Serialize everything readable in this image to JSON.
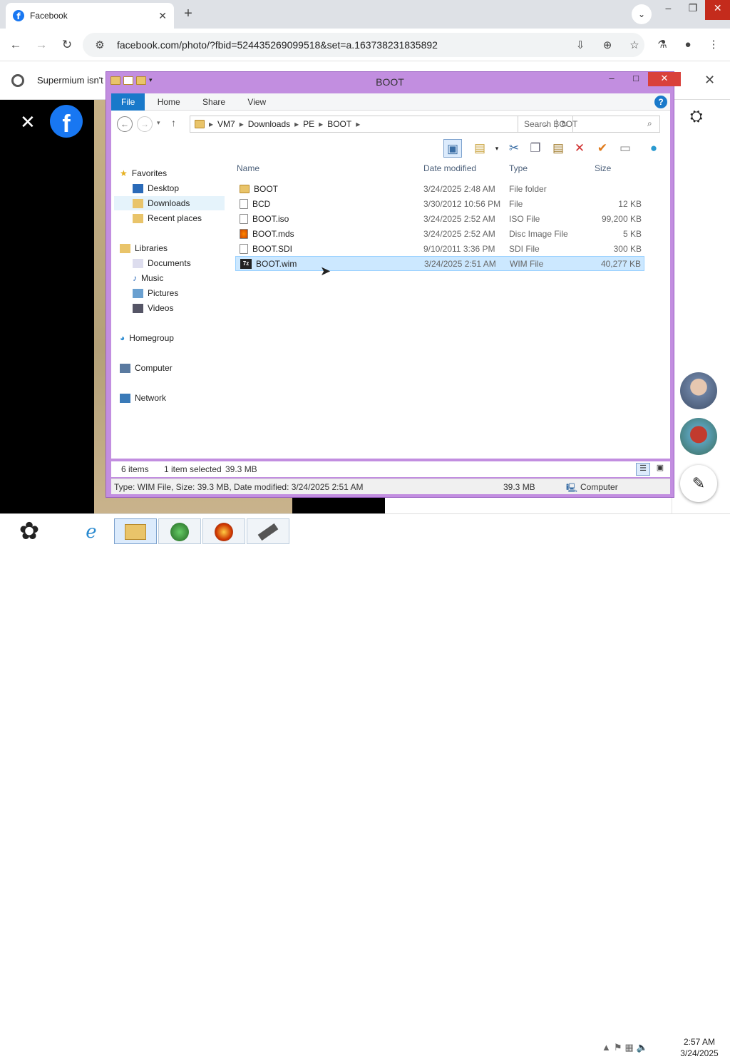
{
  "browser": {
    "tab_title": "Facebook",
    "tab_close": "✕",
    "new_tab": "+",
    "tab_search": "⌄",
    "url": "facebook.com/photo/?fbid=524435269099518&set=a.163738231835892",
    "infobar_text": "Supermium isn't",
    "infobar_close": "✕"
  },
  "page": {
    "close_photo": "✕",
    "fb_logo": "f"
  },
  "explorer": {
    "title": "BOOT",
    "ribbon_tabs": [
      "File",
      "Home",
      "Share",
      "View"
    ],
    "breadcrumb": [
      "VM7",
      "Downloads",
      "PE",
      "BOOT"
    ],
    "search_placeholder": "Search BOOT",
    "nav": {
      "favorites": "Favorites",
      "desktop": "Desktop",
      "downloads": "Downloads",
      "recent": "Recent places",
      "libraries": "Libraries",
      "documents": "Documents",
      "music": "Music",
      "pictures": "Pictures",
      "videos": "Videos",
      "homegroup": "Homegroup",
      "computer": "Computer",
      "network": "Network"
    },
    "columns": {
      "name": "Name",
      "date": "Date modified",
      "type": "Type",
      "size": "Size"
    },
    "files": [
      {
        "name": "BOOT",
        "date": "3/24/2025 2:48 AM",
        "type": "File folder",
        "size": ""
      },
      {
        "name": "BCD",
        "date": "3/30/2012 10:56 PM",
        "type": "File",
        "size": "12 KB"
      },
      {
        "name": "BOOT.iso",
        "date": "3/24/2025 2:52 AM",
        "type": "ISO File",
        "size": "99,200 KB"
      },
      {
        "name": "BOOT.mds",
        "date": "3/24/2025 2:52 AM",
        "type": "Disc Image File",
        "size": "5 KB"
      },
      {
        "name": "BOOT.SDI",
        "date": "9/10/2011 3:36 PM",
        "type": "SDI File",
        "size": "300 KB"
      },
      {
        "name": "BOOT.wim",
        "date": "3/24/2025 2:51 AM",
        "type": "WIM File",
        "size": "40,277 KB"
      }
    ],
    "status": {
      "items": "6 items",
      "selected": "1 item selected",
      "selected_size": "39.3 MB"
    },
    "details": {
      "text": "Type: WIM File, Size: 39.3 MB, Date modified: 3/24/2025 2:51 AM",
      "size": "39.3 MB",
      "location": "Computer"
    }
  },
  "taskbar": {
    "time": "2:57 AM",
    "date": "3/24/2025"
  }
}
